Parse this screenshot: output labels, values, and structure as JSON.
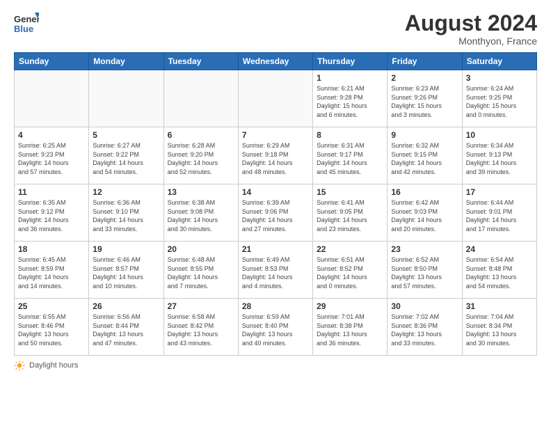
{
  "header": {
    "logo_line1": "General",
    "logo_line2": "Blue",
    "month_title": "August 2024",
    "subtitle": "Monthyon, France"
  },
  "weekdays": [
    "Sunday",
    "Monday",
    "Tuesday",
    "Wednesday",
    "Thursday",
    "Friday",
    "Saturday"
  ],
  "weeks": [
    [
      {
        "day": "",
        "info": ""
      },
      {
        "day": "",
        "info": ""
      },
      {
        "day": "",
        "info": ""
      },
      {
        "day": "",
        "info": ""
      },
      {
        "day": "1",
        "info": "Sunrise: 6:21 AM\nSunset: 9:28 PM\nDaylight: 15 hours\nand 6 minutes."
      },
      {
        "day": "2",
        "info": "Sunrise: 6:23 AM\nSunset: 9:26 PM\nDaylight: 15 hours\nand 3 minutes."
      },
      {
        "day": "3",
        "info": "Sunrise: 6:24 AM\nSunset: 9:25 PM\nDaylight: 15 hours\nand 0 minutes."
      }
    ],
    [
      {
        "day": "4",
        "info": "Sunrise: 6:25 AM\nSunset: 9:23 PM\nDaylight: 14 hours\nand 57 minutes."
      },
      {
        "day": "5",
        "info": "Sunrise: 6:27 AM\nSunset: 9:22 PM\nDaylight: 14 hours\nand 54 minutes."
      },
      {
        "day": "6",
        "info": "Sunrise: 6:28 AM\nSunset: 9:20 PM\nDaylight: 14 hours\nand 52 minutes."
      },
      {
        "day": "7",
        "info": "Sunrise: 6:29 AM\nSunset: 9:18 PM\nDaylight: 14 hours\nand 48 minutes."
      },
      {
        "day": "8",
        "info": "Sunrise: 6:31 AM\nSunset: 9:17 PM\nDaylight: 14 hours\nand 45 minutes."
      },
      {
        "day": "9",
        "info": "Sunrise: 6:32 AM\nSunset: 9:15 PM\nDaylight: 14 hours\nand 42 minutes."
      },
      {
        "day": "10",
        "info": "Sunrise: 6:34 AM\nSunset: 9:13 PM\nDaylight: 14 hours\nand 39 minutes."
      }
    ],
    [
      {
        "day": "11",
        "info": "Sunrise: 6:35 AM\nSunset: 9:12 PM\nDaylight: 14 hours\nand 36 minutes."
      },
      {
        "day": "12",
        "info": "Sunrise: 6:36 AM\nSunset: 9:10 PM\nDaylight: 14 hours\nand 33 minutes."
      },
      {
        "day": "13",
        "info": "Sunrise: 6:38 AM\nSunset: 9:08 PM\nDaylight: 14 hours\nand 30 minutes."
      },
      {
        "day": "14",
        "info": "Sunrise: 6:39 AM\nSunset: 9:06 PM\nDaylight: 14 hours\nand 27 minutes."
      },
      {
        "day": "15",
        "info": "Sunrise: 6:41 AM\nSunset: 9:05 PM\nDaylight: 14 hours\nand 23 minutes."
      },
      {
        "day": "16",
        "info": "Sunrise: 6:42 AM\nSunset: 9:03 PM\nDaylight: 14 hours\nand 20 minutes."
      },
      {
        "day": "17",
        "info": "Sunrise: 6:44 AM\nSunset: 9:01 PM\nDaylight: 14 hours\nand 17 minutes."
      }
    ],
    [
      {
        "day": "18",
        "info": "Sunrise: 6:45 AM\nSunset: 8:59 PM\nDaylight: 14 hours\nand 14 minutes."
      },
      {
        "day": "19",
        "info": "Sunrise: 6:46 AM\nSunset: 8:57 PM\nDaylight: 14 hours\nand 10 minutes."
      },
      {
        "day": "20",
        "info": "Sunrise: 6:48 AM\nSunset: 8:55 PM\nDaylight: 14 hours\nand 7 minutes."
      },
      {
        "day": "21",
        "info": "Sunrise: 6:49 AM\nSunset: 8:53 PM\nDaylight: 14 hours\nand 4 minutes."
      },
      {
        "day": "22",
        "info": "Sunrise: 6:51 AM\nSunset: 8:52 PM\nDaylight: 14 hours\nand 0 minutes."
      },
      {
        "day": "23",
        "info": "Sunrise: 6:52 AM\nSunset: 8:50 PM\nDaylight: 13 hours\nand 57 minutes."
      },
      {
        "day": "24",
        "info": "Sunrise: 6:54 AM\nSunset: 8:48 PM\nDaylight: 13 hours\nand 54 minutes."
      }
    ],
    [
      {
        "day": "25",
        "info": "Sunrise: 6:55 AM\nSunset: 8:46 PM\nDaylight: 13 hours\nand 50 minutes."
      },
      {
        "day": "26",
        "info": "Sunrise: 6:56 AM\nSunset: 8:44 PM\nDaylight: 13 hours\nand 47 minutes."
      },
      {
        "day": "27",
        "info": "Sunrise: 6:58 AM\nSunset: 8:42 PM\nDaylight: 13 hours\nand 43 minutes."
      },
      {
        "day": "28",
        "info": "Sunrise: 6:59 AM\nSunset: 8:40 PM\nDaylight: 13 hours\nand 40 minutes."
      },
      {
        "day": "29",
        "info": "Sunrise: 7:01 AM\nSunset: 8:38 PM\nDaylight: 13 hours\nand 36 minutes."
      },
      {
        "day": "30",
        "info": "Sunrise: 7:02 AM\nSunset: 8:36 PM\nDaylight: 13 hours\nand 33 minutes."
      },
      {
        "day": "31",
        "info": "Sunrise: 7:04 AM\nSunset: 8:34 PM\nDaylight: 13 hours\nand 30 minutes."
      }
    ]
  ],
  "footer": {
    "label": "Daylight hours"
  }
}
